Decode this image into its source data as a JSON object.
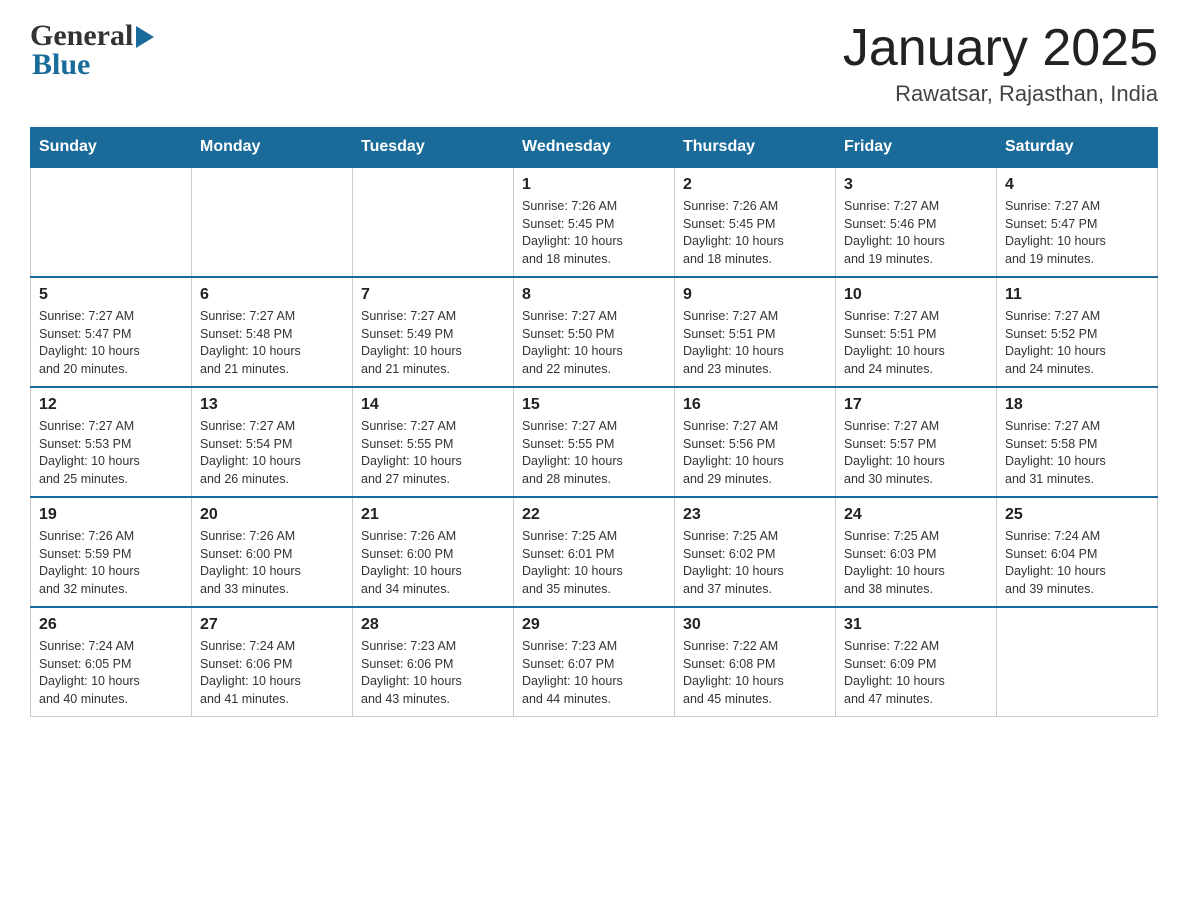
{
  "header": {
    "logo_general": "General",
    "logo_blue": "Blue",
    "title": "January 2025",
    "subtitle": "Rawatsar, Rajasthan, India"
  },
  "calendar": {
    "headers": [
      "Sunday",
      "Monday",
      "Tuesday",
      "Wednesday",
      "Thursday",
      "Friday",
      "Saturday"
    ],
    "weeks": [
      {
        "days": [
          {
            "number": "",
            "info": ""
          },
          {
            "number": "",
            "info": ""
          },
          {
            "number": "",
            "info": ""
          },
          {
            "number": "1",
            "info": "Sunrise: 7:26 AM\nSunset: 5:45 PM\nDaylight: 10 hours\nand 18 minutes."
          },
          {
            "number": "2",
            "info": "Sunrise: 7:26 AM\nSunset: 5:45 PM\nDaylight: 10 hours\nand 18 minutes."
          },
          {
            "number": "3",
            "info": "Sunrise: 7:27 AM\nSunset: 5:46 PM\nDaylight: 10 hours\nand 19 minutes."
          },
          {
            "number": "4",
            "info": "Sunrise: 7:27 AM\nSunset: 5:47 PM\nDaylight: 10 hours\nand 19 minutes."
          }
        ]
      },
      {
        "days": [
          {
            "number": "5",
            "info": "Sunrise: 7:27 AM\nSunset: 5:47 PM\nDaylight: 10 hours\nand 20 minutes."
          },
          {
            "number": "6",
            "info": "Sunrise: 7:27 AM\nSunset: 5:48 PM\nDaylight: 10 hours\nand 21 minutes."
          },
          {
            "number": "7",
            "info": "Sunrise: 7:27 AM\nSunset: 5:49 PM\nDaylight: 10 hours\nand 21 minutes."
          },
          {
            "number": "8",
            "info": "Sunrise: 7:27 AM\nSunset: 5:50 PM\nDaylight: 10 hours\nand 22 minutes."
          },
          {
            "number": "9",
            "info": "Sunrise: 7:27 AM\nSunset: 5:51 PM\nDaylight: 10 hours\nand 23 minutes."
          },
          {
            "number": "10",
            "info": "Sunrise: 7:27 AM\nSunset: 5:51 PM\nDaylight: 10 hours\nand 24 minutes."
          },
          {
            "number": "11",
            "info": "Sunrise: 7:27 AM\nSunset: 5:52 PM\nDaylight: 10 hours\nand 24 minutes."
          }
        ]
      },
      {
        "days": [
          {
            "number": "12",
            "info": "Sunrise: 7:27 AM\nSunset: 5:53 PM\nDaylight: 10 hours\nand 25 minutes."
          },
          {
            "number": "13",
            "info": "Sunrise: 7:27 AM\nSunset: 5:54 PM\nDaylight: 10 hours\nand 26 minutes."
          },
          {
            "number": "14",
            "info": "Sunrise: 7:27 AM\nSunset: 5:55 PM\nDaylight: 10 hours\nand 27 minutes."
          },
          {
            "number": "15",
            "info": "Sunrise: 7:27 AM\nSunset: 5:55 PM\nDaylight: 10 hours\nand 28 minutes."
          },
          {
            "number": "16",
            "info": "Sunrise: 7:27 AM\nSunset: 5:56 PM\nDaylight: 10 hours\nand 29 minutes."
          },
          {
            "number": "17",
            "info": "Sunrise: 7:27 AM\nSunset: 5:57 PM\nDaylight: 10 hours\nand 30 minutes."
          },
          {
            "number": "18",
            "info": "Sunrise: 7:27 AM\nSunset: 5:58 PM\nDaylight: 10 hours\nand 31 minutes."
          }
        ]
      },
      {
        "days": [
          {
            "number": "19",
            "info": "Sunrise: 7:26 AM\nSunset: 5:59 PM\nDaylight: 10 hours\nand 32 minutes."
          },
          {
            "number": "20",
            "info": "Sunrise: 7:26 AM\nSunset: 6:00 PM\nDaylight: 10 hours\nand 33 minutes."
          },
          {
            "number": "21",
            "info": "Sunrise: 7:26 AM\nSunset: 6:00 PM\nDaylight: 10 hours\nand 34 minutes."
          },
          {
            "number": "22",
            "info": "Sunrise: 7:25 AM\nSunset: 6:01 PM\nDaylight: 10 hours\nand 35 minutes."
          },
          {
            "number": "23",
            "info": "Sunrise: 7:25 AM\nSunset: 6:02 PM\nDaylight: 10 hours\nand 37 minutes."
          },
          {
            "number": "24",
            "info": "Sunrise: 7:25 AM\nSunset: 6:03 PM\nDaylight: 10 hours\nand 38 minutes."
          },
          {
            "number": "25",
            "info": "Sunrise: 7:24 AM\nSunset: 6:04 PM\nDaylight: 10 hours\nand 39 minutes."
          }
        ]
      },
      {
        "days": [
          {
            "number": "26",
            "info": "Sunrise: 7:24 AM\nSunset: 6:05 PM\nDaylight: 10 hours\nand 40 minutes."
          },
          {
            "number": "27",
            "info": "Sunrise: 7:24 AM\nSunset: 6:06 PM\nDaylight: 10 hours\nand 41 minutes."
          },
          {
            "number": "28",
            "info": "Sunrise: 7:23 AM\nSunset: 6:06 PM\nDaylight: 10 hours\nand 43 minutes."
          },
          {
            "number": "29",
            "info": "Sunrise: 7:23 AM\nSunset: 6:07 PM\nDaylight: 10 hours\nand 44 minutes."
          },
          {
            "number": "30",
            "info": "Sunrise: 7:22 AM\nSunset: 6:08 PM\nDaylight: 10 hours\nand 45 minutes."
          },
          {
            "number": "31",
            "info": "Sunrise: 7:22 AM\nSunset: 6:09 PM\nDaylight: 10 hours\nand 47 minutes."
          },
          {
            "number": "",
            "info": ""
          }
        ]
      }
    ]
  }
}
